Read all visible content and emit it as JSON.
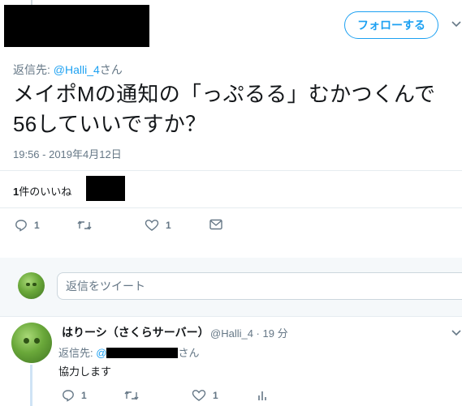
{
  "header": {
    "follow_label": "フォローする"
  },
  "tweet": {
    "reply_to_prefix": "返信先: ",
    "reply_to_mention": "@Halli_4",
    "reply_to_suffix": "さん",
    "text_line1": "メイポMの通知の「っぷるる」むかつくんで",
    "text_line2": "56していいですか？",
    "timestamp": "19:56 - 2019年4月12日",
    "likes_count": "1",
    "likes_label": "件のいいね",
    "actions": {
      "reply_count": "1",
      "retweet_count": "",
      "like_count": "1"
    }
  },
  "reply_box": {
    "placeholder": "返信をツイート"
  },
  "reply": {
    "name": "はりーシ（さくらサーバー）",
    "handle": "@Halli_4 · 19 分",
    "reply_to_prefix": "返信先: ",
    "reply_to_mention": "@",
    "reply_to_suffix": "さん",
    "text": "協力します",
    "actions": {
      "reply_count": "1",
      "retweet_count": "",
      "like_count": "1"
    }
  },
  "colors": {
    "accent": "#1da1f2",
    "muted": "#657786",
    "text": "#14171a",
    "divider": "#e6ecf0",
    "band": "#f5f8fa"
  },
  "icons": [
    "chevron-down-icon",
    "reply-icon",
    "retweet-icon",
    "like-icon",
    "dm-icon",
    "analytics-icon"
  ]
}
